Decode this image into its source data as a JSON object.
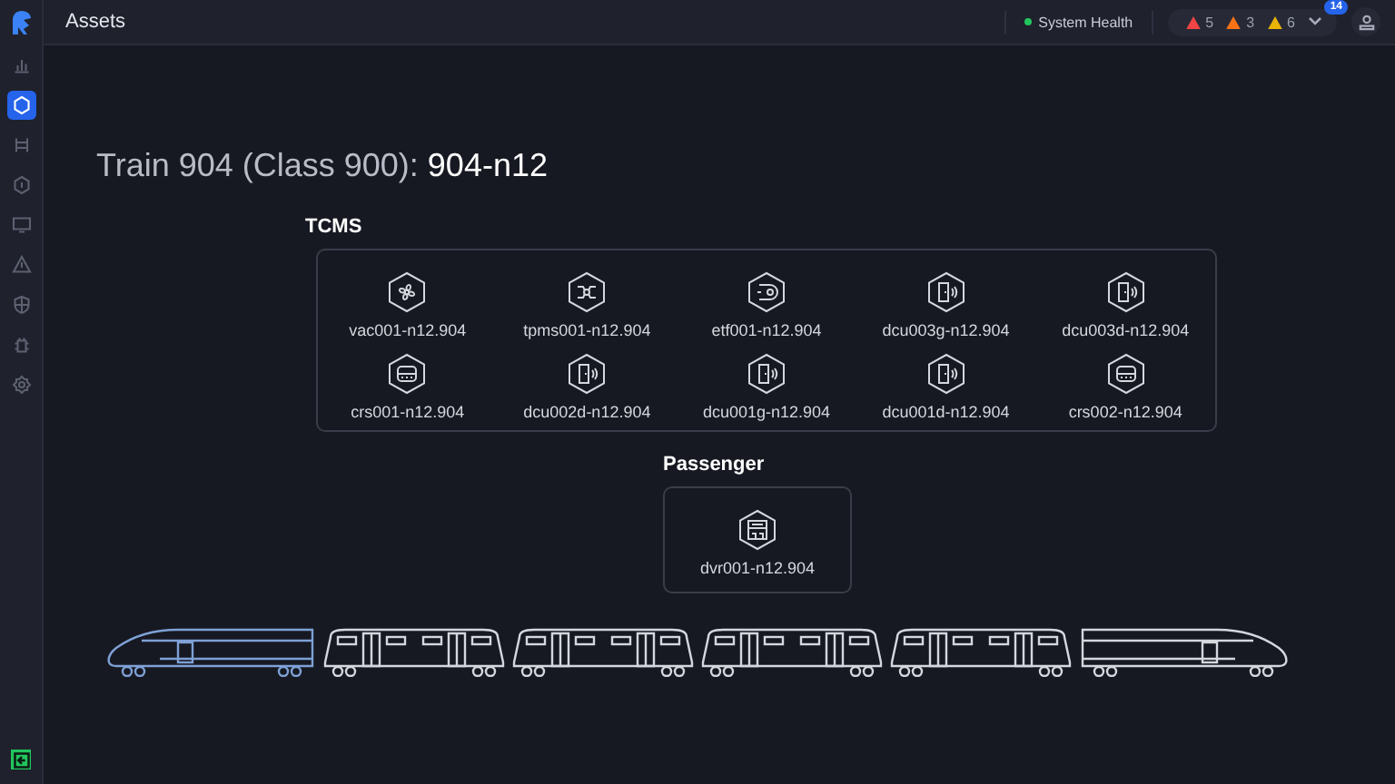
{
  "header": {
    "title": "Assets",
    "system_health": {
      "label": "System Health",
      "color": "#22c55e"
    },
    "alerts": [
      {
        "count": "5",
        "color": "#ef4444"
      },
      {
        "count": "3",
        "color": "#f97316"
      },
      {
        "count": "6",
        "color": "#eab308"
      }
    ],
    "notification_badge": "14"
  },
  "sidebar": {
    "items": [
      {
        "selected": false
      },
      {
        "selected": true
      },
      {
        "selected": false
      },
      {
        "selected": false
      },
      {
        "selected": false
      },
      {
        "selected": false
      },
      {
        "selected": false
      },
      {
        "selected": false
      },
      {
        "selected": false
      }
    ]
  },
  "page": {
    "title_prefix": "Train 904 (Class 900):",
    "title_id": "904-n12"
  },
  "groups": [
    {
      "name": "TCMS",
      "devices": [
        {
          "label": "vac001-n12.904",
          "kind": "fan"
        },
        {
          "label": "tpms001-n12.904",
          "kind": "split"
        },
        {
          "label": "etf001-n12.904",
          "kind": "disc"
        },
        {
          "label": "dcu003g-n12.904",
          "kind": "door"
        },
        {
          "label": "dcu003d-n12.904",
          "kind": "door"
        },
        {
          "label": "crs001-n12.904",
          "kind": "seat"
        },
        {
          "label": "dcu002d-n12.904",
          "kind": "door"
        },
        {
          "label": "dcu001g-n12.904",
          "kind": "door"
        },
        {
          "label": "dcu001d-n12.904",
          "kind": "door"
        },
        {
          "label": "crs002-n12.904",
          "kind": "seat"
        }
      ]
    },
    {
      "name": "Passenger",
      "devices": [
        {
          "label": "dvr001-n12.904",
          "kind": "recorder"
        }
      ]
    }
  ],
  "train": {
    "cars": [
      {
        "kind": "lead",
        "selected": true
      },
      {
        "kind": "coach",
        "selected": false
      },
      {
        "kind": "coach",
        "selected": false
      },
      {
        "kind": "coach",
        "selected": false
      },
      {
        "kind": "coach",
        "selected": false
      },
      {
        "kind": "tail",
        "selected": false
      }
    ]
  }
}
